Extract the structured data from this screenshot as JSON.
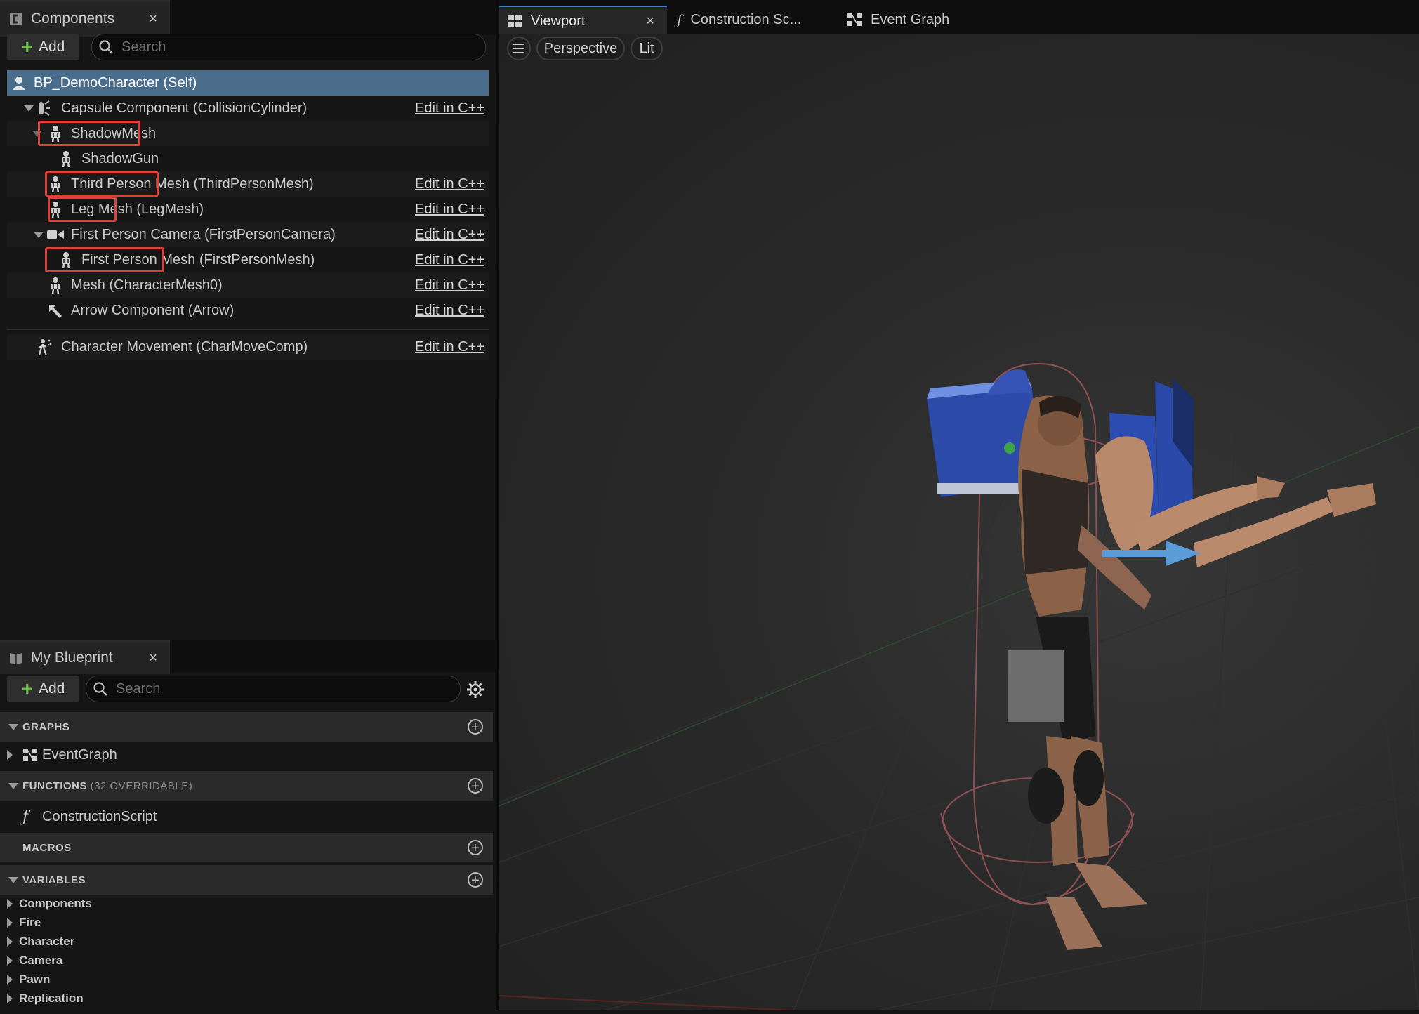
{
  "components_panel": {
    "tab_label": "Components",
    "close": "×",
    "add_label": "Add",
    "search_placeholder": "Search",
    "edit_label": "Edit in C++",
    "rows": [
      {
        "label": "BP_DemoCharacter (Self)"
      },
      {
        "label": "Capsule Component (CollisionCylinder)"
      },
      {
        "label": "ShadowMesh"
      },
      {
        "label": "ShadowGun"
      },
      {
        "label": "Third Person Mesh",
        "sub": " (ThirdPersonMesh)"
      },
      {
        "label": "Leg Mesh",
        "sub": " (LegMesh)"
      },
      {
        "label": "First Person Camera (FirstPersonCamera)"
      },
      {
        "label": "First Person Mesh",
        "sub": " (FirstPersonMesh)"
      },
      {
        "label": "Mesh (CharacterMesh0)"
      },
      {
        "label": "Arrow Component (Arrow)"
      },
      {
        "label": "Character Movement (CharMoveComp)"
      }
    ]
  },
  "my_blueprint": {
    "tab_label": "My Blueprint",
    "close": "×",
    "add_label": "Add",
    "search_placeholder": "Search",
    "sections": {
      "graphs": "GRAPHS",
      "functions": "FUNCTIONS",
      "functions_sub": "(32 OVERRIDABLE)",
      "macros": "MACROS",
      "variables": "VARIABLES"
    },
    "graph_item": "EventGraph",
    "function_item": "ConstructionScript",
    "variables": [
      "Components",
      "Fire",
      "Character",
      "Camera",
      "Pawn",
      "Replication"
    ]
  },
  "viewport": {
    "tabs": [
      "Viewport",
      "Construction Sc...",
      "Event Graph"
    ],
    "close": "×",
    "perspective": "Perspective",
    "lit": "Lit"
  },
  "colors": {
    "selection": "#4a6d8c",
    "highlight": "#e0403a",
    "accent": "#3d7fc8",
    "add_plus": "#6dc34a"
  }
}
